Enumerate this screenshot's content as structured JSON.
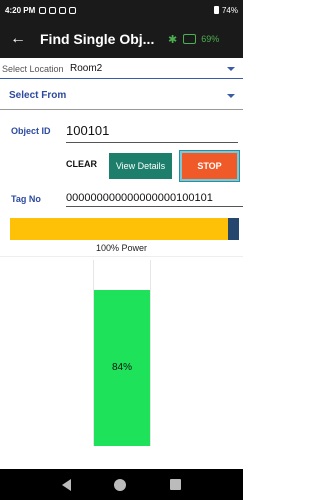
{
  "status": {
    "time": "4:20 PM",
    "battery": "74%"
  },
  "app_bar": {
    "title": "Find Single Obj...",
    "signal_pct": "69%"
  },
  "select_location": {
    "label": "Select Location",
    "value": "Room2"
  },
  "select_from": {
    "label": "Select From"
  },
  "object_id": {
    "label": "Object ID",
    "value": "100101"
  },
  "buttons": {
    "clear": "CLEAR",
    "view_details": "View Details",
    "stop": "STOP"
  },
  "tag_no": {
    "label": "Tag No",
    "value": "000000000000000000100101"
  },
  "power": {
    "label": "100% Power",
    "level": 1.0
  },
  "meter": {
    "label": "84%",
    "level": 0.84
  },
  "colors": {
    "accent": "#2c4a9e",
    "stop": "#f05a28",
    "view": "#1d7f6b",
    "power": "#ffc107",
    "meter": "#1ee35a"
  }
}
